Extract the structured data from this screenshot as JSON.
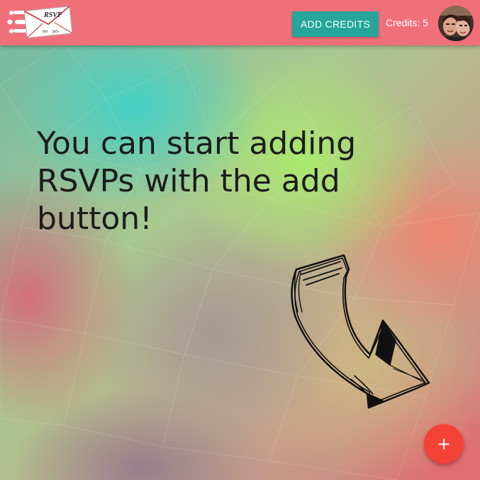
{
  "header": {
    "logo": {
      "title": "RSVP",
      "no_label": "no",
      "yes_label": "yes"
    },
    "add_credits_label": "ADD CREDITS",
    "credits_text": "Credits: 5"
  },
  "main": {
    "empty_message": "You can start adding RSVPs with the add button!"
  },
  "fab": {
    "icon": "plus-icon",
    "symbol": "+"
  },
  "colors": {
    "header_bg": "#f0707a",
    "add_credits_bg": "#26a69a",
    "fab_bg": "#f44336"
  }
}
